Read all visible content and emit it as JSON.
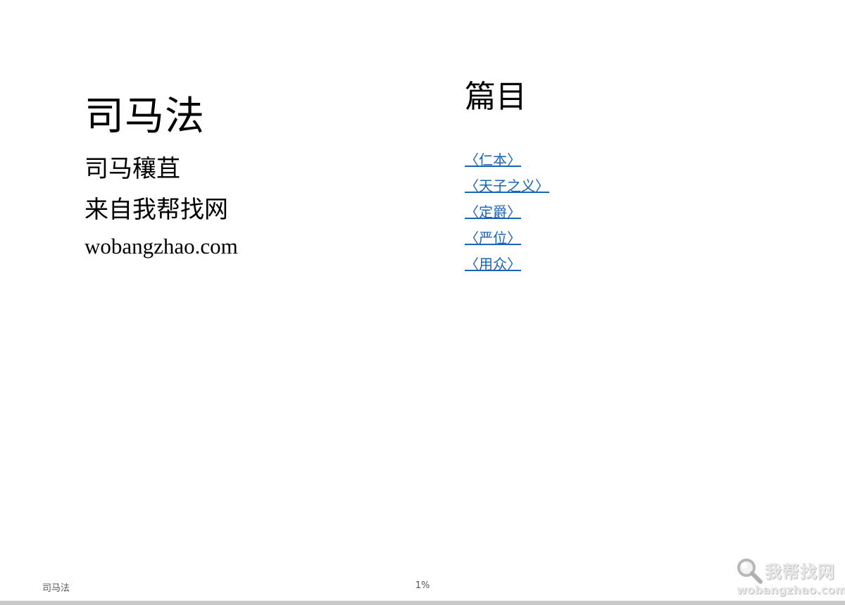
{
  "book": {
    "title": "司马法",
    "author": "司马穰苴",
    "source": "来自我帮找网",
    "site": "wobangzhao.com"
  },
  "toc": {
    "heading": "篇目",
    "items": [
      {
        "label": "〈仁本〉"
      },
      {
        "label": "〈天子之义〉"
      },
      {
        "label": "〈定爵〉"
      },
      {
        "label": "〈严位〉"
      },
      {
        "label": "〈用众〉"
      }
    ]
  },
  "footer": {
    "book_title": "司马法",
    "progress": "1%"
  },
  "watermark": {
    "cn": "我帮找网",
    "en": "wobangzhao.com",
    "icon": "magnifier-icon"
  },
  "colors": {
    "link": "#1a63b5",
    "text": "#000000",
    "footer_text": "#555555",
    "bottom_bar": "#c8c8c8"
  }
}
